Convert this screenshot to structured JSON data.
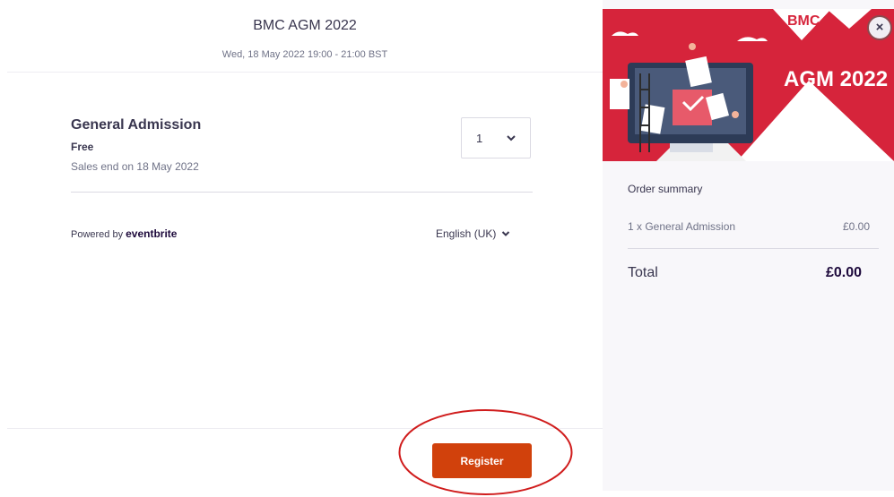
{
  "event": {
    "title": "BMC AGM 2022",
    "date": "Wed, 18 May 2022 19:00 - 21:00 BST"
  },
  "ticket": {
    "name": "General Admission",
    "price": "Free",
    "sales_end": "Sales end on 18 May 2022",
    "quantity": "1"
  },
  "footer": {
    "powered_by": "Powered by",
    "brand": "eventbrite",
    "language": "English (UK)",
    "register_label": "Register"
  },
  "banner": {
    "logo_text": "BMC",
    "headline": "AGM 2022"
  },
  "close_label": "×",
  "order_summary": {
    "title": "Order summary",
    "item_label": "1 x General Admission",
    "item_value": "£0.00",
    "total_label": "Total",
    "total_value": "£0.00"
  },
  "colors": {
    "register": "#d1410c",
    "banner_red": "#d6243b",
    "annotation": "#d01c1c"
  }
}
